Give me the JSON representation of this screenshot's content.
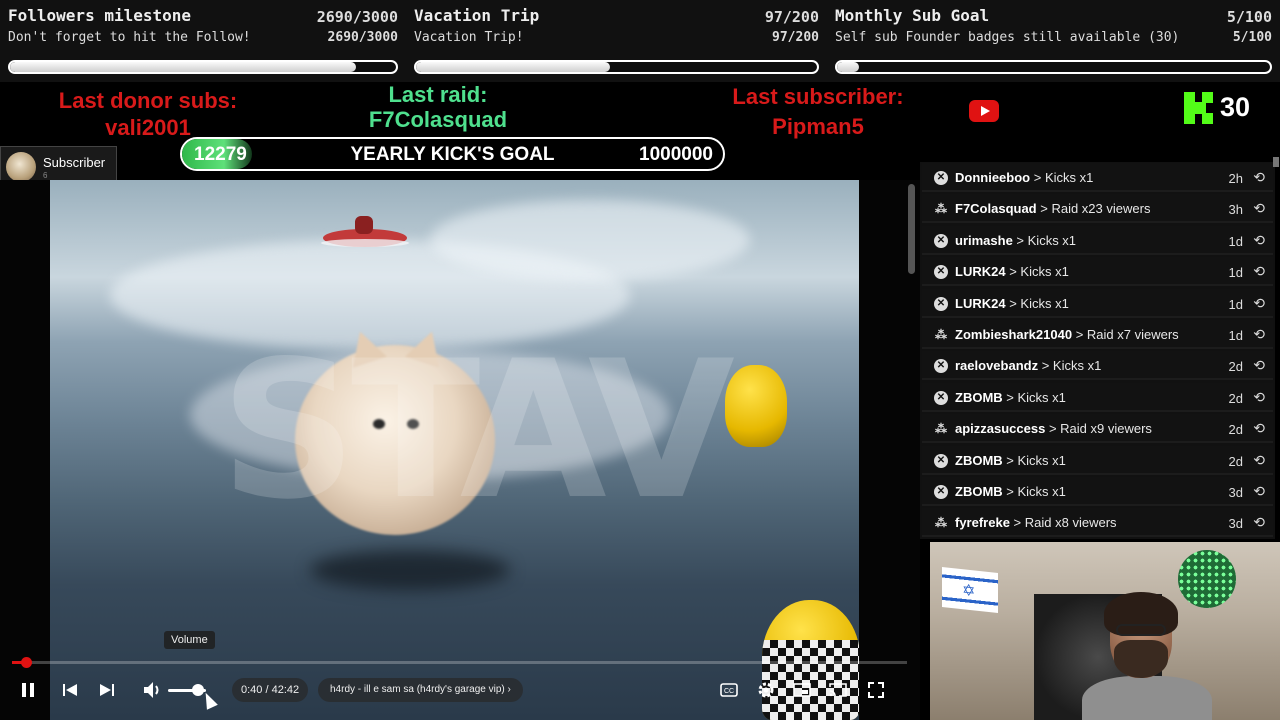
{
  "goals": [
    {
      "title": "Followers milestone",
      "count": "2690/3000",
      "subtitle": "Don't forget to hit the Follow!",
      "count2": "2690/3000",
      "progress": 0.897
    },
    {
      "title": "Vacation Trip",
      "count": "97/200",
      "subtitle": "Vacation Trip!",
      "count2": "97/200",
      "progress": 0.485
    },
    {
      "title": "Monthly Sub Goal",
      "count": "5/100",
      "subtitle": "Self sub Founder badges still available (30)",
      "count2": "5/100",
      "progress": 0.05
    }
  ],
  "stats": {
    "donor_label": "Last donor subs:",
    "donor_name": "vali2001",
    "raid_label": "Last raid:",
    "raid_name": "F7Colasquad",
    "subscriber_label": "Last subscriber:",
    "subscriber_name": "Pipman5",
    "kick_count": "30"
  },
  "yearly_goal": {
    "current": "12279",
    "label": "YEARLY KICK'S GOAL",
    "target": "1000000",
    "progress": 0.012279
  },
  "subscriber_chip": {
    "label": "Subscriber",
    "count": "6"
  },
  "player": {
    "watermark": "STAV",
    "volume_tooltip": "Volume",
    "time": "0:40 / 42:42",
    "video_title": "h4rdy - ill e sam sa (h4rdy's garage vip)",
    "progress": 0.0156,
    "volume": 0.8
  },
  "events": [
    {
      "type": "kick",
      "user": "Donnieeboo",
      "detail": "Kicks x1",
      "age": "2h"
    },
    {
      "type": "raid",
      "user": "F7Colasquad",
      "detail": "Raid x23 viewers",
      "age": "3h"
    },
    {
      "type": "kick",
      "user": "urimashe",
      "detail": "Kicks x1",
      "age": "1d"
    },
    {
      "type": "kick",
      "user": "LURK24",
      "detail": "Kicks x1",
      "age": "1d"
    },
    {
      "type": "kick",
      "user": "LURK24",
      "detail": "Kicks x1",
      "age": "1d"
    },
    {
      "type": "raid",
      "user": "Zombieshark21040",
      "detail": "Raid x7 viewers",
      "age": "1d"
    },
    {
      "type": "kick",
      "user": "raelovebandz",
      "detail": "Kicks x1",
      "age": "2d"
    },
    {
      "type": "kick",
      "user": "ZBOMB",
      "detail": "Kicks x1",
      "age": "2d"
    },
    {
      "type": "raid",
      "user": "apizzasuccess",
      "detail": "Raid x9 viewers",
      "age": "2d"
    },
    {
      "type": "kick",
      "user": "ZBOMB",
      "detail": "Kicks x1",
      "age": "2d"
    },
    {
      "type": "kick",
      "user": "ZBOMB",
      "detail": "Kicks x1",
      "age": "3d"
    },
    {
      "type": "raid",
      "user": "fyrefreke",
      "detail": "Raid x8 viewers",
      "age": "3d"
    }
  ],
  "icons": {
    "kick": "kick-icon",
    "raid": "raid-icon",
    "replay": "replay-icon",
    "youtube": "youtube-icon"
  },
  "colors": {
    "accent_red": "#d81a1a",
    "accent_green": "#4fe08e",
    "kick_green": "#53fc18",
    "player_red": "#e01212"
  }
}
